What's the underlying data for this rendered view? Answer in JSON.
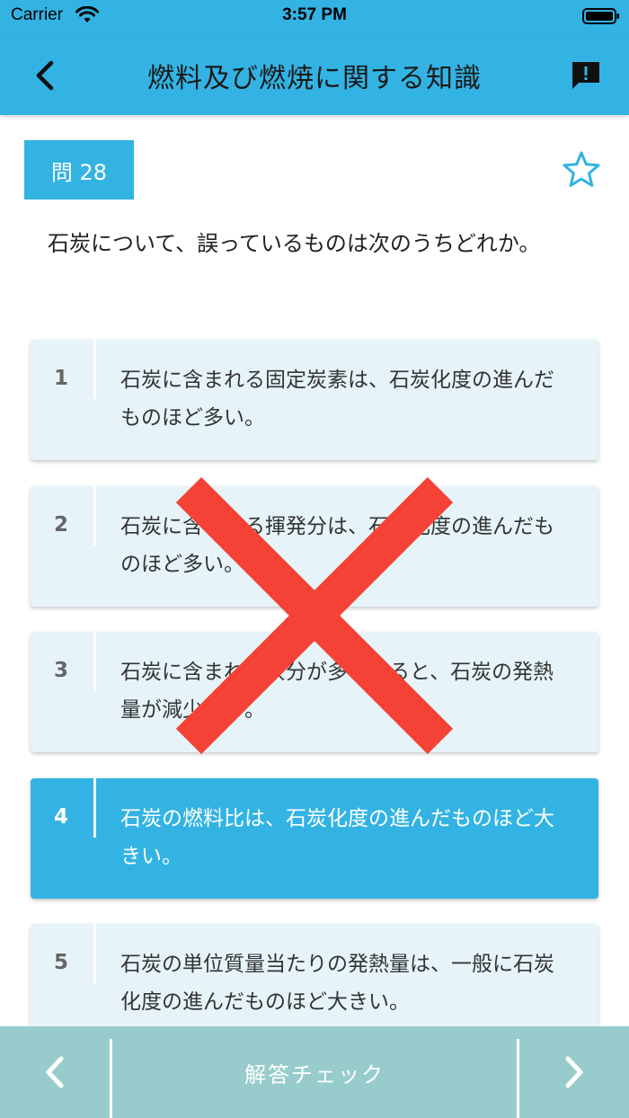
{
  "status_bar": {
    "carrier": "Carrier",
    "time": "3:57 PM"
  },
  "header": {
    "title": "燃料及び燃焼に関する知識",
    "back_icon": "chevron-left-icon",
    "report_icon": "report-bubble-icon"
  },
  "question": {
    "number_label": "問 28",
    "text": "石炭について、誤っているものは次のうちどれか。",
    "favorite_icon": "star-outline-icon"
  },
  "choices": [
    {
      "number": "1",
      "text": "石炭に含まれる固定炭素は、石炭化度の進んだものほど多い。",
      "selected": false
    },
    {
      "number": "2",
      "text": "石炭に含まれる揮発分は、石炭化度の進んだものほど多い。",
      "selected": false
    },
    {
      "number": "3",
      "text": "石炭に含まれる灰分が多くなると、石炭の発熱量が減少する。",
      "selected": false
    },
    {
      "number": "4",
      "text": "石炭の燃料比は、石炭化度の進んだものほど大きい。",
      "selected": true
    },
    {
      "number": "5",
      "text": "石炭の単位質量当たりの発熱量は、一般に石炭化度の進んだものほど大きい。",
      "selected": false
    }
  ],
  "result": {
    "mark": "wrong-x-icon",
    "color": "#f44336"
  },
  "footer": {
    "check_label": "解答チェック",
    "prev_icon": "chevron-left-icon",
    "next_icon": "chevron-right-icon"
  },
  "colors": {
    "accent": "#33b3e3",
    "choice_bg": "#e6f4fa",
    "footer_bg": "#98cccc"
  }
}
